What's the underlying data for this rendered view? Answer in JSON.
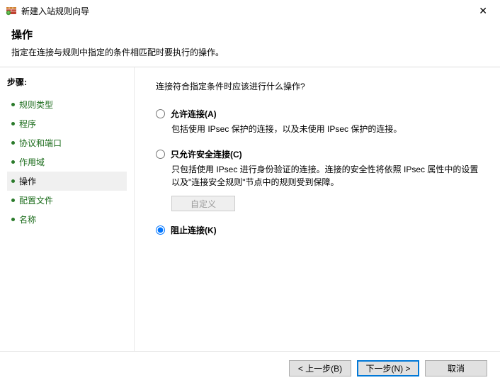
{
  "window": {
    "title": "新建入站规则向导"
  },
  "header": {
    "title": "操作",
    "desc": "指定在连接与规则中指定的条件相匹配时要执行的操作。"
  },
  "sidebar": {
    "heading": "步骤:",
    "items": [
      {
        "label": "规则类型"
      },
      {
        "label": "程序"
      },
      {
        "label": "协议和端口"
      },
      {
        "label": "作用域"
      },
      {
        "label": "操作"
      },
      {
        "label": "配置文件"
      },
      {
        "label": "名称"
      }
    ]
  },
  "content": {
    "prompt": "连接符合指定条件时应该进行什么操作?",
    "options": [
      {
        "label": "允许连接(A)",
        "desc": "包括使用 IPsec 保护的连接，以及未使用 IPsec 保护的连接。"
      },
      {
        "label": "只允许安全连接(C)",
        "desc": "只包括使用 IPsec 进行身份验证的连接。连接的安全性将依照 IPsec 属性中的设置以及\"连接安全规则\"节点中的规则受到保障。"
      },
      {
        "label": "阻止连接(K)"
      }
    ],
    "customize_label": "自定义"
  },
  "footer": {
    "back": "< 上一步(B)",
    "next": "下一步(N) >",
    "cancel": "取消"
  }
}
